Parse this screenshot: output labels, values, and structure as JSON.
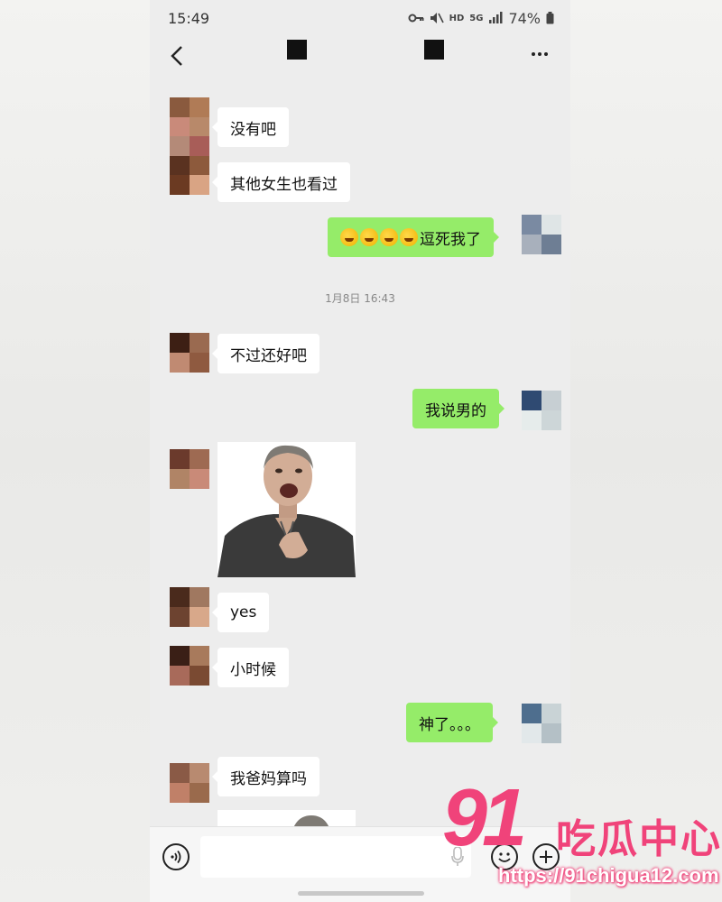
{
  "status_bar": {
    "time": "15:49",
    "network": "5G",
    "hd": "HD",
    "battery": "74%",
    "icons": [
      "key-icon",
      "mute-icon",
      "signal-icon",
      "battery-icon"
    ]
  },
  "nav": {
    "back_icon": "chevron-left-icon",
    "more_icon": "more-dots-icon"
  },
  "messages": [
    {
      "side": "left",
      "type": "text",
      "text": "没有吧"
    },
    {
      "side": "left",
      "type": "text",
      "text": "其他女生也看过"
    },
    {
      "side": "right",
      "type": "text",
      "emoji": "rofl-emoji x4",
      "text": "逗死我了"
    },
    {
      "type": "timestamp",
      "text": "1月8日 16:43"
    },
    {
      "side": "left",
      "type": "text",
      "text": "不过还好吧"
    },
    {
      "side": "right",
      "type": "text",
      "text": "我说男的"
    },
    {
      "side": "left",
      "type": "sticker",
      "text": ""
    },
    {
      "side": "left",
      "type": "text",
      "text": "yes"
    },
    {
      "side": "left",
      "type": "text",
      "text": "小时候"
    },
    {
      "side": "right",
      "type": "text",
      "text": "神了。。。"
    },
    {
      "side": "left",
      "type": "text",
      "text": "我爸妈算吗"
    },
    {
      "side": "left",
      "type": "sticker",
      "text": ""
    }
  ],
  "input_bar": {
    "voice_icon": "voice-mode-icon",
    "mic_icon": "microphone-icon",
    "emoji_icon": "emoji-icon",
    "plus_icon": "plus-icon",
    "input_value": ""
  },
  "watermark": {
    "number": "91",
    "name": "吃瓜中心",
    "url": "https://91chigua12.com"
  },
  "colors": {
    "sent_bubble": "#95ec69",
    "received_bubble": "#ffffff",
    "chat_bg": "#ededed",
    "watermark": "#f0437a"
  }
}
